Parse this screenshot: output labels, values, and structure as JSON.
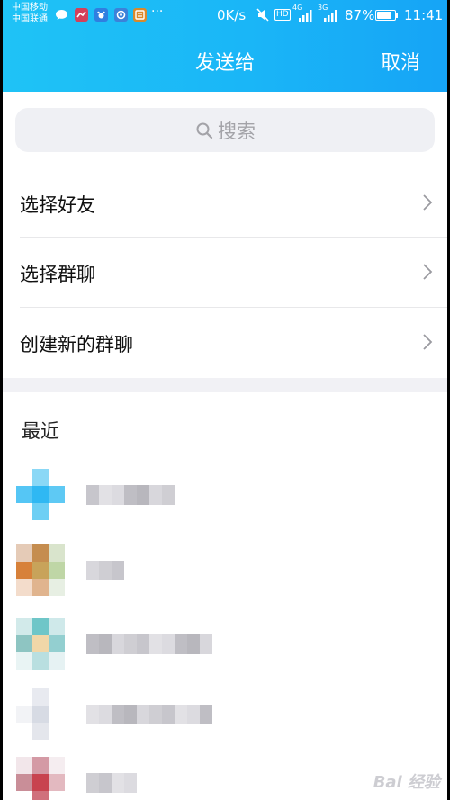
{
  "status_bar": {
    "carrier_1": "中国移动",
    "carrier_2": "中国联通",
    "speed": "0K/s",
    "hd": "HD",
    "net_1": "4G",
    "net_2": "3G",
    "battery_text": "87%",
    "battery_level": 0.87,
    "time": "11:41",
    "overflow": "···"
  },
  "header": {
    "title": "发送给",
    "cancel_label": "取消"
  },
  "search": {
    "placeholder": "搜索"
  },
  "menu": {
    "items": [
      {
        "label": "选择好友"
      },
      {
        "label": "选择群聊"
      },
      {
        "label": "创建新的群聊"
      }
    ]
  },
  "recent": {
    "title": "最近",
    "contacts": [
      {
        "avatar_colors": [
          "#ffffff",
          "#8ad8f6",
          "#ffffff",
          "#55c6f5",
          "#2fb8f3",
          "#5ec9f4",
          "#ffffff",
          "#6dcff4",
          "#ffffff"
        ],
        "name_blocks": 7
      },
      {
        "avatar_colors": [
          "#e5cbb7",
          "#c58d4f",
          "#d9e4cc",
          "#d7813a",
          "#c8a35a",
          "#bfd6a6",
          "#f3dccb",
          "#e0b48e",
          "#e7efe3"
        ],
        "name_blocks": 3
      },
      {
        "avatar_colors": [
          "#d2eaea",
          "#6fc6c8",
          "#cfe9ea",
          "#8ec5c2",
          "#f1d7a8",
          "#93cfd0",
          "#e9f4f4",
          "#b9dfe0",
          "#e6f2f3"
        ],
        "name_blocks": 10
      },
      {
        "avatar_colors": [
          "#ffffff",
          "#e8eaf0",
          "#ffffff",
          "#f2f3f6",
          "#d7dbe4",
          "#ffffff",
          "#ffffff",
          "#e4e6ec",
          "#ffffff"
        ],
        "name_blocks": 10
      },
      {
        "avatar_colors": [
          "#f2e6ea",
          "#d49aa5",
          "#f5edf0",
          "#c98e98",
          "#c8434f",
          "#e3b9c0",
          "#ffffff",
          "#d0707c",
          "#ffffff"
        ],
        "name_blocks": 4
      }
    ]
  },
  "watermark": "Bai 经验"
}
